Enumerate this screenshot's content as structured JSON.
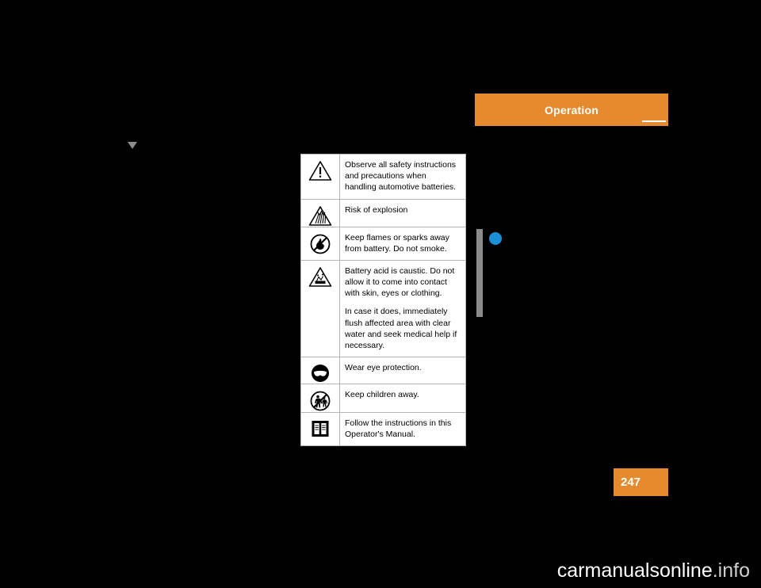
{
  "header": {
    "section_label": "Operation"
  },
  "page": {
    "number": "247"
  },
  "markers": {
    "triangle_icon": "triangle-down-marker",
    "side_track_icon": "vertical-grey-bar",
    "blue_dot_icon": "blue-dot-marker"
  },
  "safety_table": {
    "rows": [
      {
        "icon": "warning-triangle-icon",
        "paragraphs": [
          "Observe all safety instructions and precautions when handling automotive batteries."
        ]
      },
      {
        "icon": "explosion-risk-icon",
        "paragraphs": [
          "Risk of explosion"
        ]
      },
      {
        "icon": "no-flames-no-smoking-icon",
        "paragraphs": [
          "Keep flames or sparks away from battery. Do not smoke."
        ]
      },
      {
        "icon": "corrosive-acid-icon",
        "paragraphs": [
          "Battery acid is caustic. Do not allow it to come into contact with skin, eyes or clothing.",
          "In case it does, immediately flush affected area with clear water and seek medical help if necessary."
        ]
      },
      {
        "icon": "eye-protection-icon",
        "paragraphs": [
          "Wear eye protection."
        ]
      },
      {
        "icon": "keep-children-away-icon",
        "paragraphs": [
          "Keep children away."
        ]
      },
      {
        "icon": "operators-manual-icon",
        "paragraphs": [
          "Follow the instructions in this Operator's Manual."
        ]
      }
    ]
  },
  "footer": {
    "watermark_part1": "carmanuals",
    "watermark_part2": "online",
    "watermark_part3": ".info"
  }
}
